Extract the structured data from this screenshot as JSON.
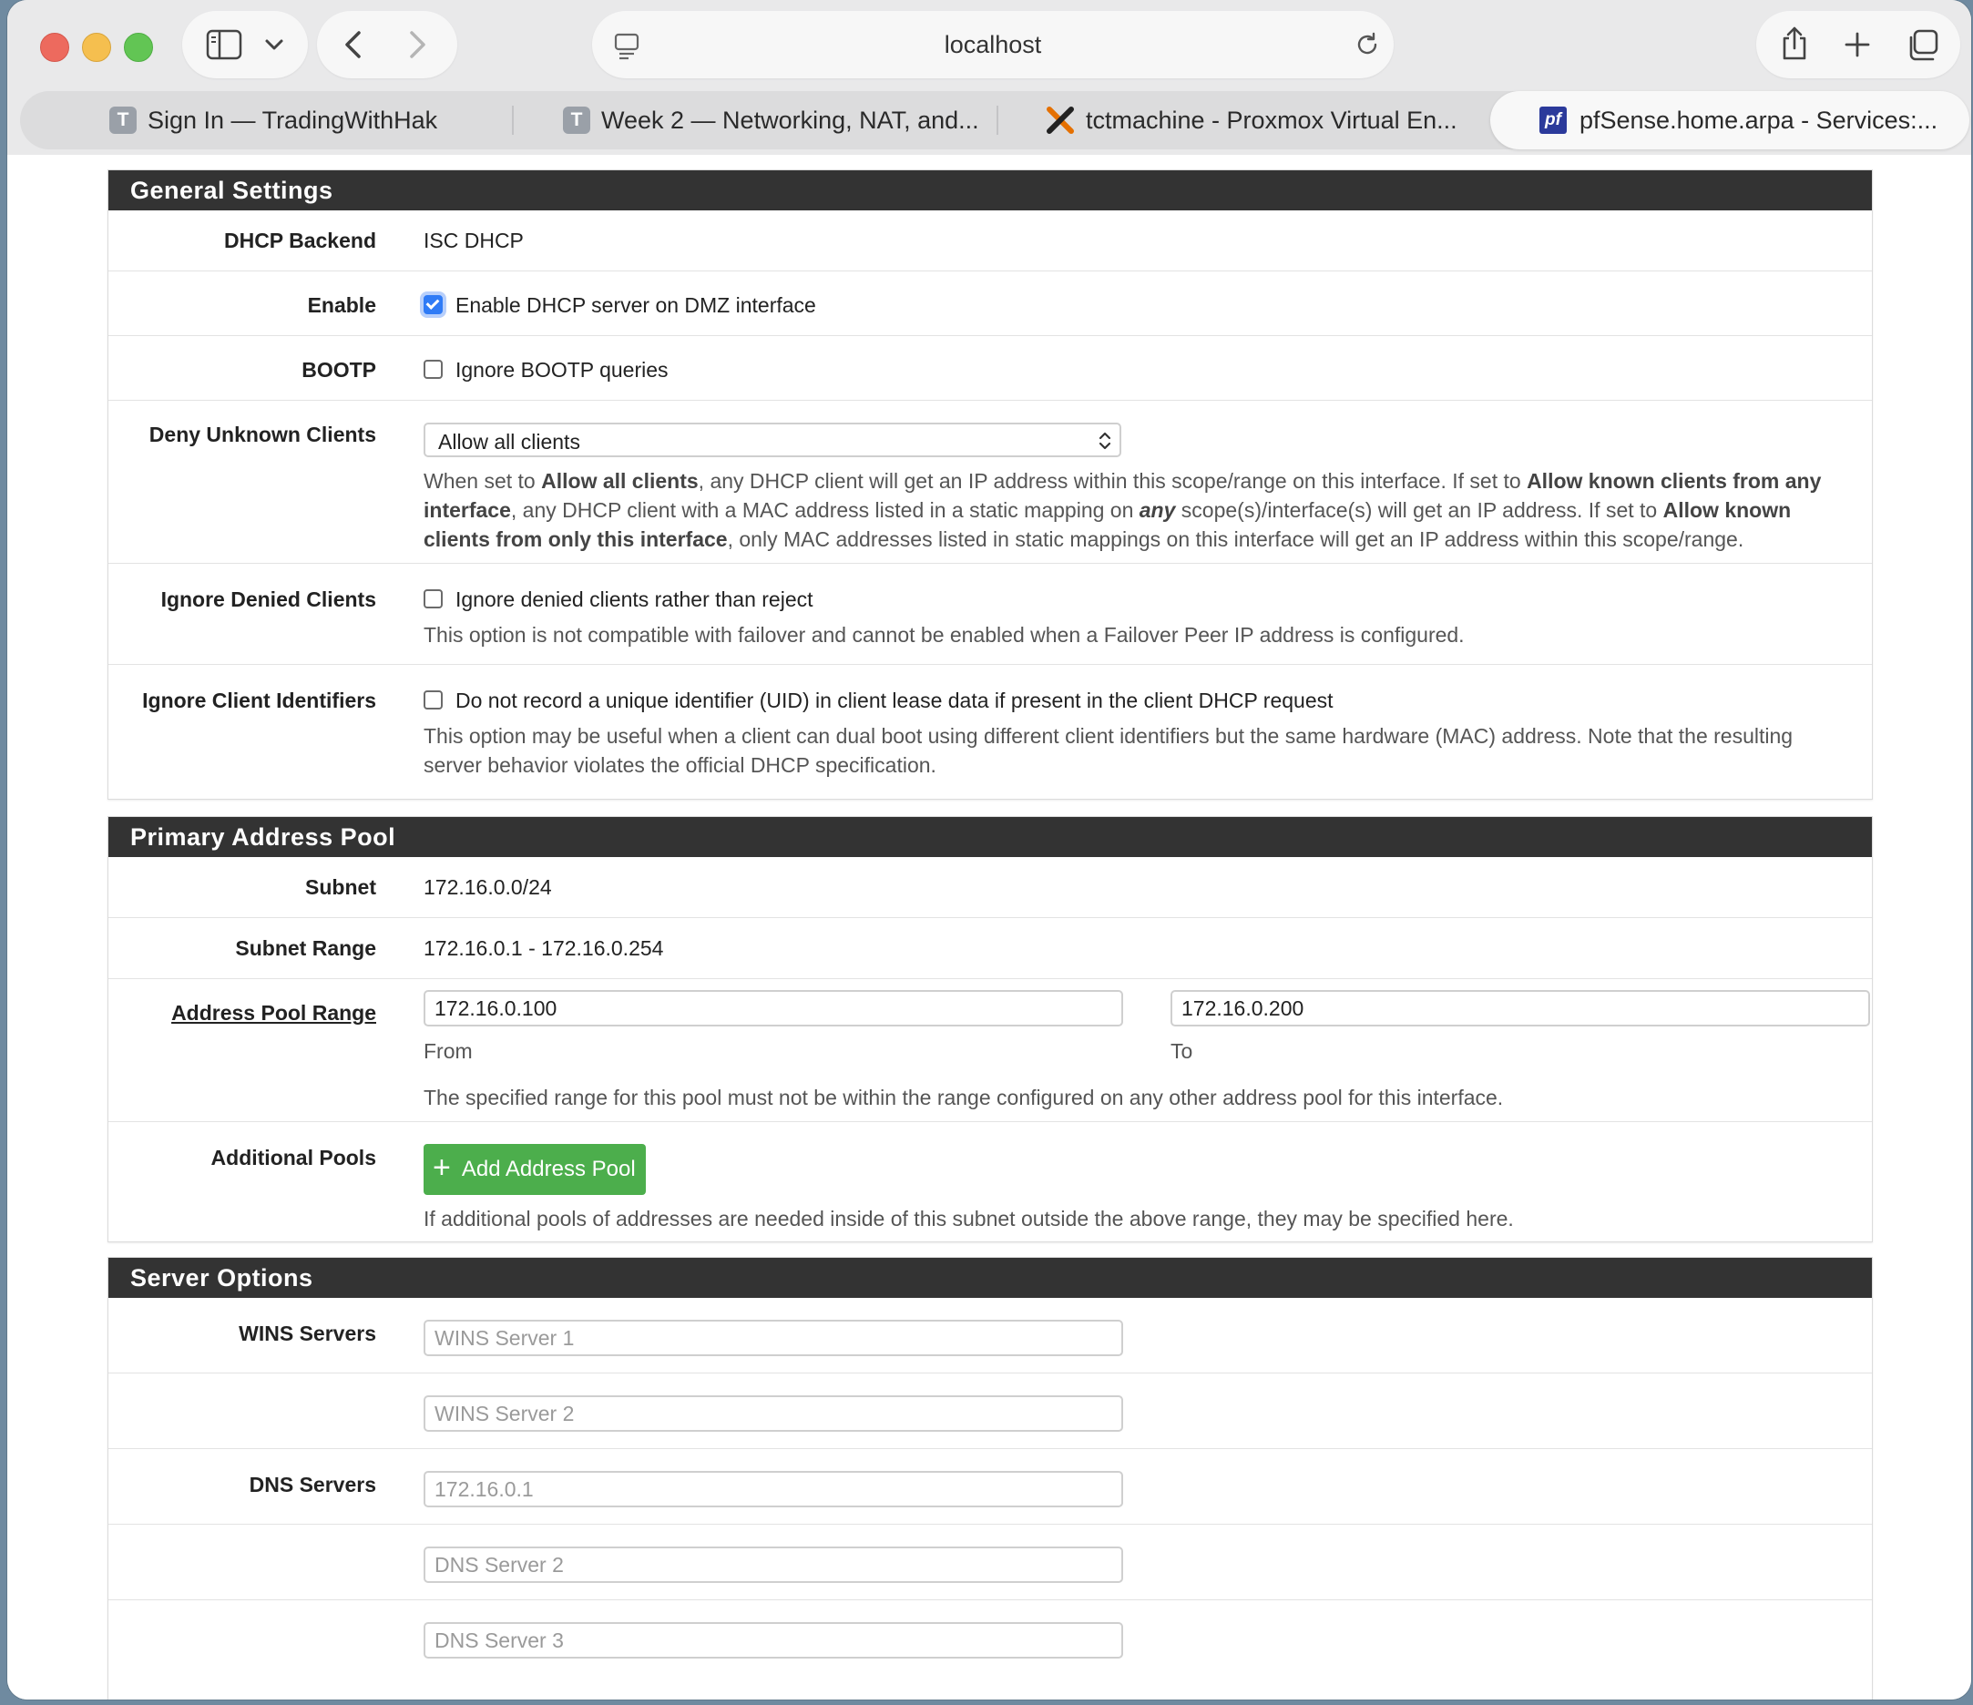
{
  "browser": {
    "url": "localhost",
    "tabs": [
      {
        "favicon": "T",
        "title": "Sign In — TradingWithHak"
      },
      {
        "favicon": "T",
        "title": "Week 2 — Networking, NAT, and..."
      },
      {
        "favicon": "proxmox-x-icon",
        "title": "tctmachine - Proxmox Virtual En..."
      },
      {
        "favicon": "pf",
        "title": "pfSense.home.arpa - Services:..."
      }
    ]
  },
  "general": {
    "heading": "General Settings",
    "backend": {
      "label": "DHCP Backend",
      "value": "ISC DHCP"
    },
    "enable": {
      "label": "Enable",
      "checked": true,
      "text": "Enable DHCP server on DMZ interface"
    },
    "bootp": {
      "label": "BOOTP",
      "checked": false,
      "text": "Ignore BOOTP queries"
    },
    "deny": {
      "label": "Deny Unknown Clients",
      "selected": "Allow all clients",
      "help": {
        "p1": "When set to ",
        "b1": "Allow all clients",
        "p2": ", any DHCP client will get an IP address within this scope/range on this interface. If set to ",
        "b2": "Allow known clients from any interface",
        "p3": ", any DHCP client with a MAC address listed in a static mapping on ",
        "b3": "any",
        "p4": " scope(s)/interface(s) will get an IP address. If set to ",
        "b4": "Allow known clients from only this interface",
        "p5": ", only MAC addresses listed in static mappings on this interface will get an IP address within this scope/range."
      }
    },
    "ignore_denied": {
      "label": "Ignore Denied Clients",
      "checked": false,
      "text": "Ignore denied clients rather than reject",
      "help": "This option is not compatible with failover and cannot be enabled when a Failover Peer IP address is configured."
    },
    "ignore_uid": {
      "label": "Ignore Client Identifiers",
      "checked": false,
      "text": "Do not record a unique identifier (UID) in client lease data if present in the client DHCP request",
      "help1": "This option may be useful when a client can dual boot using different client identifiers but the same hardware (MAC) address. Note that the resulting",
      "help2": "server behavior violates the official DHCP specification."
    }
  },
  "pool": {
    "heading": "Primary Address Pool",
    "subnet": {
      "label": "Subnet",
      "value": "172.16.0.0/24"
    },
    "range": {
      "label": "Subnet Range",
      "value": "172.16.0.1 - 172.16.0.254"
    },
    "pool_range": {
      "label": "Address Pool Range",
      "from": "172.16.0.100",
      "to": "172.16.0.200",
      "from_label": "From",
      "to_label": "To",
      "help": "The specified range for this pool must not be within the range configured on any other address pool for this interface."
    },
    "additional": {
      "label": "Additional Pools",
      "button": "Add Address Pool",
      "help": "If additional pools of addresses are needed inside of this subnet outside the above range, they may be specified here."
    }
  },
  "server": {
    "heading": "Server Options",
    "wins": {
      "label": "WINS Servers",
      "ph1": "WINS Server 1",
      "ph2": "WINS Server 2"
    },
    "dns": {
      "label": "DNS Servers",
      "ph1": "172.16.0.1",
      "ph2": "DNS Server 2",
      "ph3": "DNS Server 3"
    }
  }
}
